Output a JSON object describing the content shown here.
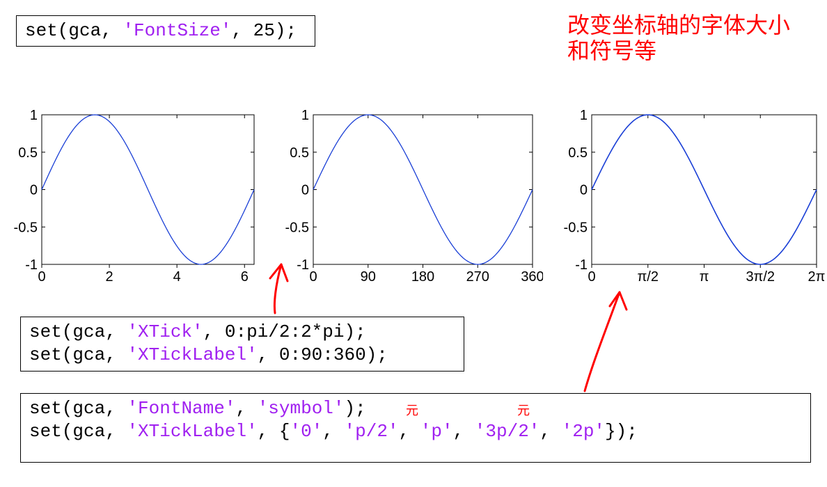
{
  "code_top": {
    "line1_pre": "set(gca, ",
    "line1_str": "'FontSize'",
    "line1_post": ", 25);"
  },
  "annotation_cn": {
    "l1": "改变坐标轴的字体大小",
    "l2": "和符号等"
  },
  "tiny_marks": {
    "a": "元",
    "b": "元"
  },
  "chart_data": [
    {
      "type": "line",
      "series": "sin(x)",
      "x_range": [
        0,
        6.2832
      ],
      "y_range": [
        -1,
        1
      ],
      "x_ticks": [
        0,
        2,
        4,
        6
      ],
      "x_tick_labels": [
        "0",
        "2",
        "4",
        "6"
      ],
      "y_ticks": [
        -1,
        -0.5,
        0,
        0.5,
        1
      ],
      "y_tick_labels": [
        "-1",
        "-0.5",
        "0",
        "0.5",
        "1"
      ],
      "data": "y = sin(x) for x in [0, 2π]"
    },
    {
      "type": "line",
      "series": "sin(x)",
      "x_range": [
        0,
        6.2832
      ],
      "y_range": [
        -1,
        1
      ],
      "x_ticks": [
        0,
        1.5708,
        3.1416,
        4.7124,
        6.2832
      ],
      "x_tick_labels": [
        "0",
        "90",
        "180",
        "270",
        "360"
      ],
      "y_ticks": [
        -1,
        -0.5,
        0,
        0.5,
        1
      ],
      "y_tick_labels": [
        "-1",
        "-0.5",
        "0",
        "0.5",
        "1"
      ],
      "data": "y = sin(x) for x in [0, 2π]"
    },
    {
      "type": "line",
      "series": "sin(x)",
      "x_range": [
        0,
        6.2832
      ],
      "y_range": [
        -1,
        1
      ],
      "x_ticks": [
        0,
        1.5708,
        3.1416,
        4.7124,
        6.2832
      ],
      "x_tick_labels": [
        "0",
        "π/2",
        "π",
        "3π/2",
        "2π"
      ],
      "y_ticks": [
        -1,
        -0.5,
        0,
        0.5,
        1
      ],
      "y_tick_labels": [
        "-1",
        "-0.5",
        "0",
        "0.5",
        "1"
      ],
      "font_family": "symbol",
      "data": "y = sin(x) for x in [0, 2π]"
    }
  ],
  "code_mid": {
    "l1_pre": "set(gca, ",
    "l1_s": "'XTick'",
    "l1_post": ", 0:pi/2:2*pi);",
    "l2_pre": "set(gca, ",
    "l2_s": "'XTickLabel'",
    "l2_post": ", 0:90:360);"
  },
  "code_bot": {
    "l1_pre": "set(gca, ",
    "l1_s1": "'FontName'",
    "l1_mid": ", ",
    "l1_s2": "'symbol'",
    "l1_post": ");",
    "l2_pre": "set(gca, ",
    "l2_s1": "'XTickLabel'",
    "l2_mid": ", {",
    "l2_a": "'0'",
    "l2_c1": ", ",
    "l2_b": "'p/2'",
    "l2_c2": ", ",
    "l2_c": "'p'",
    "l2_c3": ", ",
    "l2_d": "'3p/2'",
    "l2_c4": ", ",
    "l2_e": "'2p'",
    "l2_post": "});"
  }
}
